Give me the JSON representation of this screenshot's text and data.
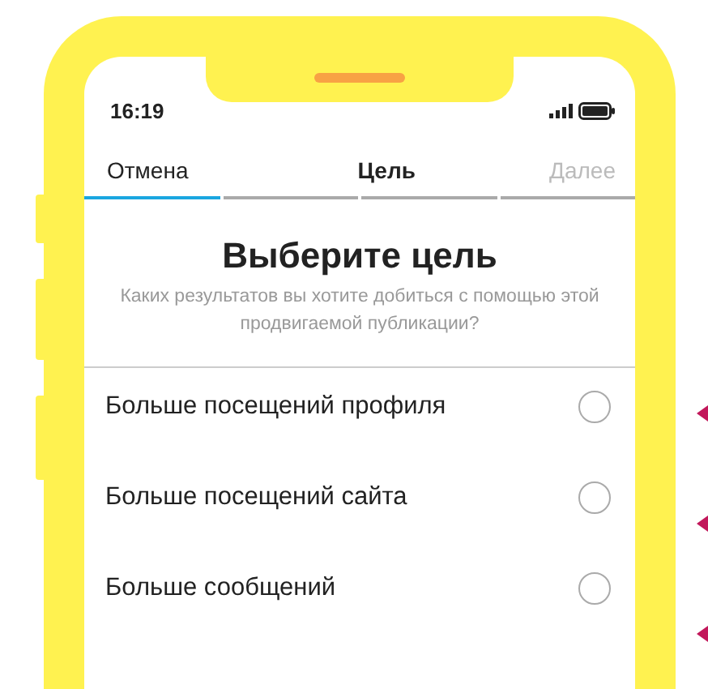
{
  "status_bar": {
    "time": "16:19"
  },
  "nav": {
    "cancel": "Отмена",
    "title": "Цель",
    "next": "Далее",
    "next_disabled": true
  },
  "progress_steps": [
    {
      "done": true
    },
    {
      "done": false
    },
    {
      "done": false
    },
    {
      "done": false
    }
  ],
  "heading": "Выберите цель",
  "subtitle": "Каких результатов вы хотите добиться с помощью этой продвигаемой публикации?",
  "options": [
    {
      "label": "Больше посещений профиля",
      "selected": false
    },
    {
      "label": "Больше посещений сайта",
      "selected": false
    },
    {
      "label": "Больше сообщений",
      "selected": false
    }
  ]
}
